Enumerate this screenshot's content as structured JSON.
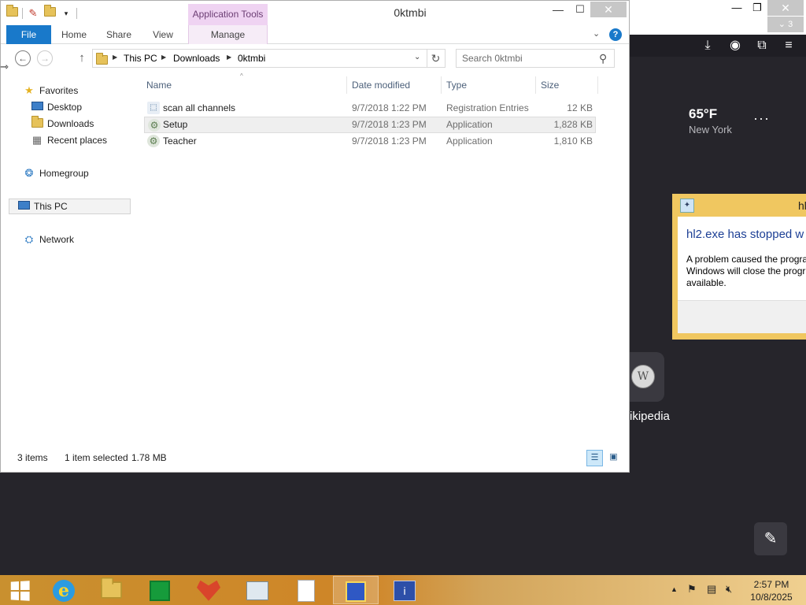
{
  "background_app": {
    "tab_count": "3",
    "weather": {
      "temperature": "65°F",
      "city": "New York",
      "more": "···"
    },
    "wikipedia_label": "ikipedia",
    "error_dialog": {
      "title": "hl",
      "heading": "hl2.exe has stopped w",
      "text_line1": "A problem caused the progra",
      "text_line2": "Windows will close the progr",
      "text_line3": "available."
    }
  },
  "explorer": {
    "title": "0ktmbi",
    "contextual_tab": "Application Tools",
    "ribbon_tabs": {
      "file": "File",
      "home": "Home",
      "share": "Share",
      "view": "View",
      "manage": "Manage"
    },
    "breadcrumb": [
      "This PC",
      "Downloads",
      "0ktmbi"
    ],
    "search_placeholder": "Search 0ktmbi",
    "nav_pane": {
      "favorites": "Favorites",
      "desktop": "Desktop",
      "downloads": "Downloads",
      "recent": "Recent places",
      "homegroup": "Homegroup",
      "thispc": "This PC",
      "network": "Network"
    },
    "columns": {
      "name": "Name",
      "date": "Date modified",
      "type": "Type",
      "size": "Size"
    },
    "files": [
      {
        "name": "scan all channels",
        "date": "9/7/2018 1:22 PM",
        "type": "Registration Entries",
        "size": "12 KB",
        "icon": "registry-file-icon"
      },
      {
        "name": "Setup",
        "date": "9/7/2018 1:23 PM",
        "type": "Application",
        "size": "1,828 KB",
        "icon": "setup-app-icon"
      },
      {
        "name": "Teacher",
        "date": "9/7/2018 1:23 PM",
        "type": "Application",
        "size": "1,810 KB",
        "icon": "teacher-app-icon"
      }
    ],
    "selected_index": 1,
    "status": {
      "count": "3 items",
      "selection": "1 item selected",
      "selection_size": "1.78 MB"
    }
  },
  "taskbar": {
    "clock_time": "2:57 PM",
    "clock_date": "10/8/2025"
  },
  "colors": {
    "file_tab": "#1979ca",
    "contextual_tab": "#efd3f2",
    "taskbar": "#cf8527",
    "dark_bg": "#26252b"
  }
}
